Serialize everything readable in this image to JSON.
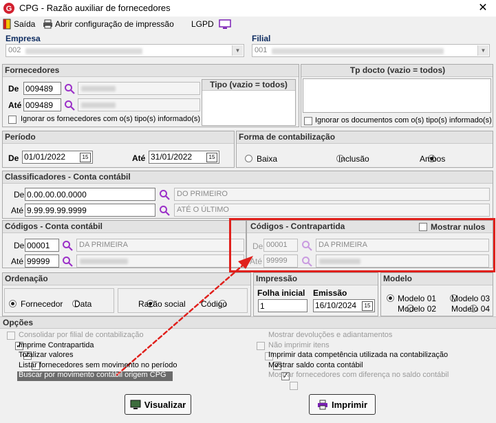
{
  "window": {
    "title": "CPG - Razão auxiliar de fornecedores",
    "close": "✕"
  },
  "toolbar": {
    "saida": "Saída",
    "config": "Abrir configuração de impressão",
    "lgpd": "LGPD"
  },
  "empresa": {
    "label": "Empresa",
    "value": "002"
  },
  "filial": {
    "label": "Filial",
    "value": "001"
  },
  "fornecedores": {
    "title": "Fornecedores",
    "de_label": "De",
    "ate_label": "Até",
    "de_value": "009489",
    "ate_value": "009489",
    "tipo_title": "Tipo (vazio = todos)",
    "ignorar": "Ignorar os fornecedores com o(s) tipo(s) informado(s)"
  },
  "tpdocto": {
    "title": "Tp docto (vazio = todos)",
    "ignorar": "Ignorar os documentos com o(s) tipo(s) informado(s)"
  },
  "periodo": {
    "title": "Período",
    "de_label": "De",
    "ate_label": "Até",
    "de_value": "01/01/2022",
    "ate_value": "31/01/2022",
    "cal": "15"
  },
  "forma": {
    "title": "Forma de contabilização",
    "baixa": "Baixa",
    "inclusao": "Inclusão",
    "ambos": "Ambos",
    "selected": "Ambos"
  },
  "classificadores": {
    "title": "Classificadores - Conta contábil",
    "de_label": "De",
    "ate_label": "Até",
    "de_value": "0.00.00.00.0000",
    "ate_value": "9.99.99.99.9999",
    "de_desc": "DO PRIMEIRO",
    "ate_desc": "ATÉ O ÚLTIMO"
  },
  "codigos_conta": {
    "title": "Códigos - Conta contábil",
    "de_label": "De",
    "ate_label": "Até",
    "de_value": "00001",
    "ate_value": "99999",
    "de_desc": "DA PRIMEIRA"
  },
  "codigos_contra": {
    "title": "Códigos - Contrapartida",
    "mostrar_nulos": "Mostrar nulos",
    "de_label": "De",
    "ate_label": "Até",
    "de_value": "00001",
    "ate_value": "99999",
    "de_desc": "DA PRIMEIRA"
  },
  "ordenacao": {
    "title": "Ordenação",
    "fornecedor": "Fornecedor",
    "data": "Data",
    "razao": "Razão social",
    "codigo": "Código"
  },
  "impressao": {
    "title": "Impressão",
    "folha_label": "Folha inicial",
    "folha_value": "1",
    "emissao_label": "Emissão",
    "emissao_value": "16/10/2024"
  },
  "modelo": {
    "title": "Modelo",
    "m1": "Modelo 01",
    "m2": "Modelo 02",
    "m3": "Modelo 03",
    "m4": "Modelo 04"
  },
  "opcoes": {
    "title": "Opções",
    "left": [
      {
        "label": "Consolidar por filial de contabilização",
        "checked": false,
        "enabled": false
      },
      {
        "label": "Imprime Contrapartida",
        "checked": true,
        "enabled": true
      },
      {
        "label": "Totalizar valores",
        "checked": true,
        "enabled": true
      },
      {
        "label": "Listar fornecedores sem movimento no período",
        "checked": false,
        "enabled": true
      },
      {
        "label": "Buscar por movimento contábil origem CPG",
        "checked": true,
        "enabled": true
      }
    ],
    "right": [
      {
        "label": "Mostrar devoluções e adiantamentos",
        "checked": false,
        "enabled": false
      },
      {
        "label": "Não imprimir itens",
        "checked": false,
        "enabled": false
      },
      {
        "label": "Imprimir data competência utilizada na contabilização",
        "checked": true,
        "enabled": true
      },
      {
        "label": "Mostrar saldo conta contábil",
        "checked": true,
        "enabled": true
      },
      {
        "label": "Mostrar fornecedores com diferença no saldo contábil",
        "checked": false,
        "enabled": false
      }
    ]
  },
  "buttons": {
    "visualizar": "Visualizar",
    "imprimir": "Imprimir"
  },
  "colors": {
    "accent_red": "#e0201c",
    "label_blue": "#0b2a5f",
    "lens_purple": "#9b30c8"
  }
}
